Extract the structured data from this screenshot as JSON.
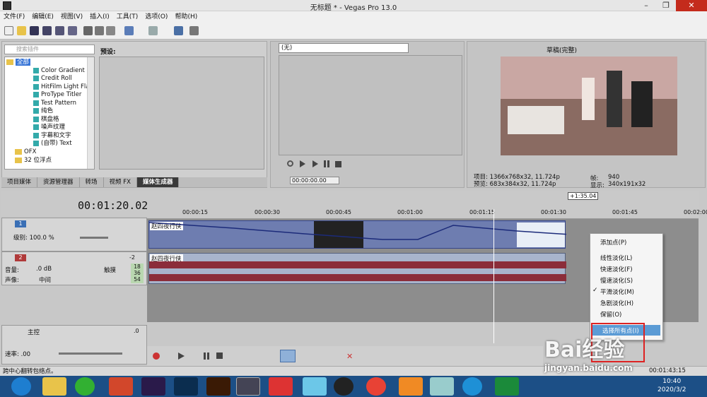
{
  "window": {
    "title": "无标题 * - Vegas Pro 13.0"
  },
  "menu": [
    "文件(F)",
    "编辑(E)",
    "视图(V)",
    "插入(I)",
    "工具(T)",
    "选项(O)",
    "帮助(H)"
  ],
  "plugins": {
    "search_placeholder": "搜索插件",
    "tree": [
      "全部",
      "Color Gradient",
      "Credit Roll",
      "HitFilm Light Fla",
      "ProType Titler",
      "Test Pattern",
      "纯色",
      "棋盘格",
      "噪声纹理",
      "字幕和文字",
      "(自带) Text",
      "OFX",
      "32 位浮点"
    ],
    "preset_label": "预设:",
    "tabs": [
      "项目媒体",
      "资源管理器",
      "转场",
      "视频 FX",
      "媒体生成器"
    ]
  },
  "trimmer": {
    "select_value": "(无)",
    "time": "00:00:00.00"
  },
  "preview": {
    "quality": "草稿(完整)",
    "project_info": "项目: 1366x768x32, 11.724p",
    "preview_info": "预览: 683x384x32, 11.724p",
    "frame_label": "帧:",
    "frame_value": "940",
    "display_label": "显示:",
    "display_value": "340x191x32"
  },
  "timeline": {
    "time_code": "00:01:20.02",
    "end_marker": "+1:35.04",
    "ruler": [
      "00:00:15",
      "00:00:30",
      "00:00:45",
      "00:01:00",
      "00:01:15",
      "00:01:30",
      "00:01:45",
      "00:02:00"
    ],
    "track1": {
      "num": "1",
      "level_label": "级别: 100.0 %"
    },
    "track2": {
      "num": "2",
      "volume_label": "音量:",
      "volume_value": ".0 dB",
      "pan_label": "声像:",
      "pan_value": "中间",
      "touch_label": "触摸",
      "meter_values": [
        "18",
        "36",
        "54"
      ],
      "peak": "-2"
    },
    "clip_name": "赵四夜行侠",
    "master": {
      "label": "主控",
      "rate_label": "速率: .00",
      "peak": ".0"
    }
  },
  "context_menu": {
    "items": [
      "添加点(P)",
      "线性淡化(L)",
      "快速淡化(F)",
      "慢速淡化(S)",
      "平滑淡化(M)",
      "急剧淡化(H)",
      "保留(O)",
      "选择所有点(I)"
    ],
    "checked_index": 4
  },
  "status_bar": {
    "text": "跨中心翻转包络点。",
    "time": "00:01:43:15"
  },
  "taskbar": {
    "time": "10:40",
    "date": "2020/3/2"
  },
  "watermark": {
    "text": "Bai经验",
    "url": "jingyan.baidu.com"
  }
}
